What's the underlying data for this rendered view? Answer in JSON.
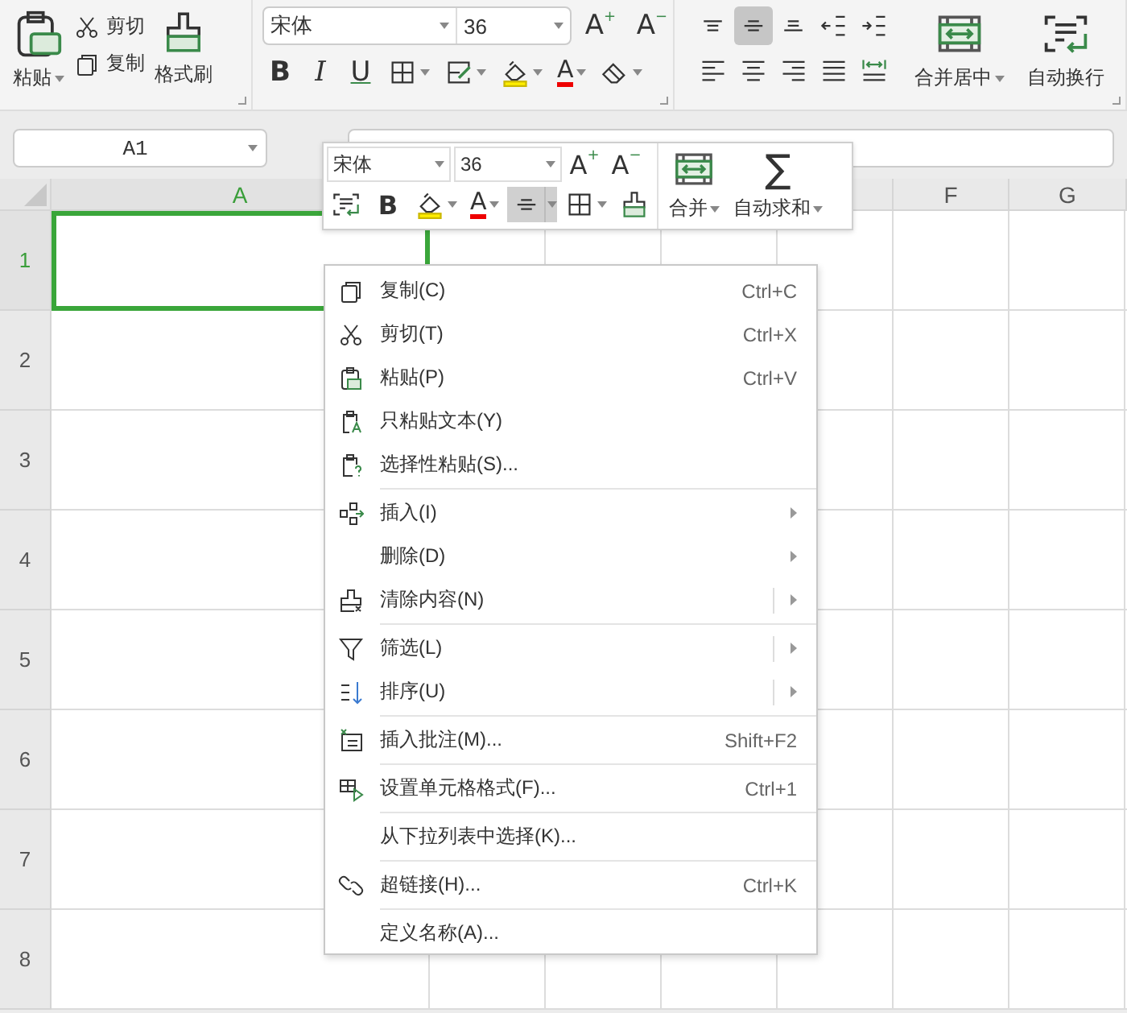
{
  "ribbon": {
    "clipboard": {
      "paste": "粘贴",
      "cut": "剪切",
      "copy": "复制",
      "format_painter": "格式刷"
    },
    "font": {
      "font_name": "宋体",
      "font_size": "36",
      "grow_glyph": "A",
      "grow_mark": "+",
      "shrink_glyph": "A",
      "shrink_mark": "−",
      "bold": "B",
      "italic": "I",
      "underline": "U",
      "font_color_glyph": "A"
    },
    "alignment": {
      "buttons": [
        {
          "selected": false
        },
        {
          "selected": true
        },
        {
          "selected": false
        },
        {
          "selected": false
        },
        {
          "selected": false
        },
        {
          "selected": false
        },
        {
          "selected": false
        },
        {
          "selected": false
        },
        {
          "selected": false
        },
        {
          "selected": false
        }
      ],
      "merge_center": "合并居中",
      "wrap_text": "自动换行"
    }
  },
  "name_box": "A1",
  "sheet": {
    "columns": [
      {
        "label": "A",
        "selected": true
      },
      {
        "label": "F",
        "selected": false
      },
      {
        "label": "G",
        "selected": false
      }
    ],
    "rows": [
      {
        "label": "1",
        "selected": true
      },
      {
        "label": "2",
        "selected": false
      },
      {
        "label": "3",
        "selected": false
      },
      {
        "label": "4",
        "selected": false
      },
      {
        "label": "5",
        "selected": false
      },
      {
        "label": "6",
        "selected": false
      },
      {
        "label": "7",
        "selected": false
      },
      {
        "label": "8",
        "selected": false
      }
    ]
  },
  "mini_toolbar": {
    "font_name": "宋体",
    "font_size": "36",
    "grow_glyph": "A",
    "grow_mark": "+",
    "shrink_glyph": "A",
    "shrink_mark": "−",
    "bold": "B",
    "font_color_glyph": "A",
    "align_selected": true,
    "sum_glyph": "∑",
    "merge": "合并",
    "autosum": "自动求和"
  },
  "context_menu": {
    "items": [
      {
        "kind": "item",
        "label": "复制(C)",
        "shortcut": "Ctrl+C"
      },
      {
        "kind": "item",
        "label": "剪切(T)",
        "shortcut": "Ctrl+X"
      },
      {
        "kind": "item",
        "label": "粘贴(P)",
        "shortcut": "Ctrl+V"
      },
      {
        "kind": "item",
        "label": "只粘贴文本(Y)"
      },
      {
        "kind": "item",
        "label": "选择性粘贴(S)..."
      },
      {
        "kind": "separator"
      },
      {
        "kind": "item",
        "label": "插入(I)",
        "submenu": true
      },
      {
        "kind": "item",
        "label": "删除(D)",
        "submenu": true
      },
      {
        "kind": "item",
        "label": "清除内容(N)",
        "submenu": true,
        "split": true
      },
      {
        "kind": "separator"
      },
      {
        "kind": "item",
        "label": "筛选(L)",
        "submenu": true,
        "split": true
      },
      {
        "kind": "item",
        "label": "排序(U)",
        "submenu": true,
        "split": true
      },
      {
        "kind": "separator"
      },
      {
        "kind": "item",
        "label": "插入批注(M)...",
        "shortcut": "Shift+F2"
      },
      {
        "kind": "separator"
      },
      {
        "kind": "item",
        "label": "设置单元格格式(F)...",
        "shortcut": "Ctrl+1"
      },
      {
        "kind": "separator"
      },
      {
        "kind": "item",
        "label": "从下拉列表中选择(K)..."
      },
      {
        "kind": "separator"
      },
      {
        "kind": "item",
        "label": "超链接(H)...",
        "shortcut": "Ctrl+K"
      },
      {
        "kind": "separator"
      },
      {
        "kind": "item",
        "label": "定义名称(A)..."
      }
    ]
  }
}
